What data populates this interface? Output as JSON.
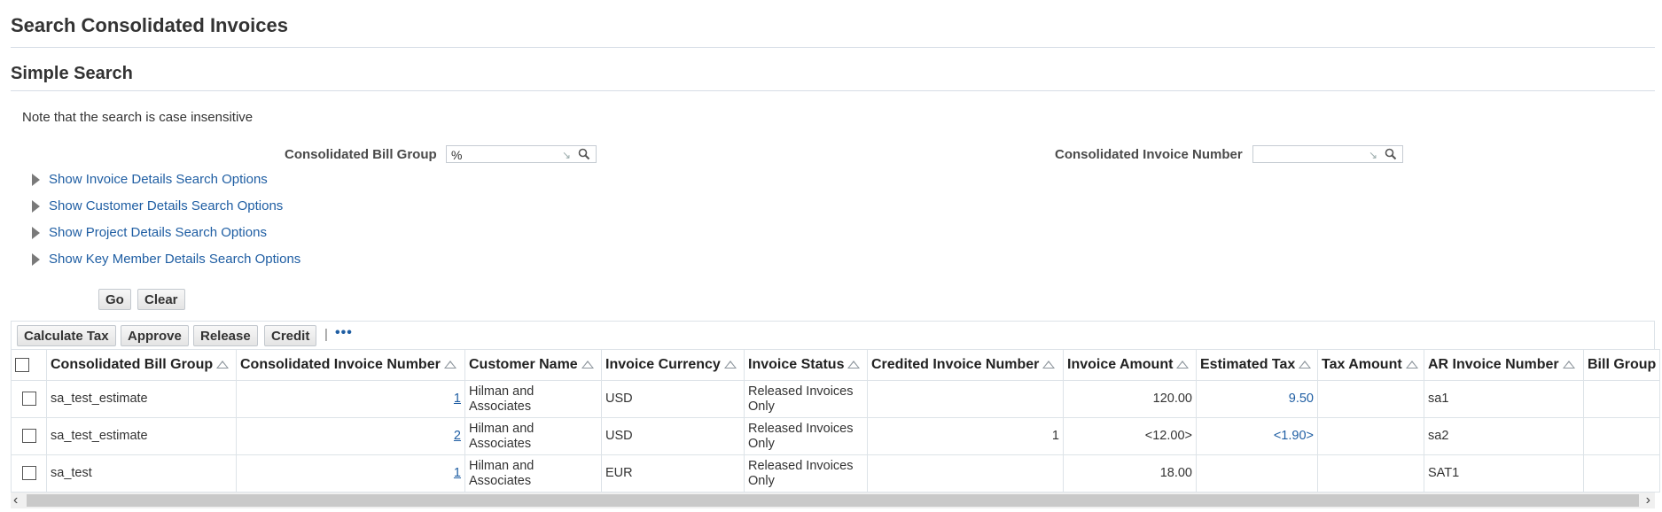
{
  "page": {
    "title": "Search Consolidated Invoices"
  },
  "simple_search": {
    "title": "Simple Search",
    "note": "Note that the search is case insensitive",
    "bill_group_label": "Consolidated Bill Group",
    "bill_group_value": "%",
    "invoice_number_label": "Consolidated Invoice Number",
    "invoice_number_value": "",
    "disclosures": [
      "Show Invoice Details Search Options",
      "Show Customer Details Search Options",
      "Show Project Details Search Options",
      "Show Key Member Details Search Options"
    ],
    "go_label": "Go",
    "clear_label": "Clear"
  },
  "toolbar": {
    "calculate_tax": "Calculate Tax",
    "approve": "Approve",
    "release": "Release",
    "credit": "Credit",
    "separator": "|",
    "more": "•••"
  },
  "table": {
    "columns": [
      "Consolidated Bill Group",
      "Consolidated Invoice Number",
      "Customer Name",
      "Invoice Currency",
      "Invoice Status",
      "Credited Invoice Number",
      "Invoice Amount",
      "Estimated Tax",
      "Tax Amount",
      "AR Invoice Number",
      "Bill Group"
    ],
    "rows": [
      {
        "bill_group": "sa_test_estimate",
        "invoice_number": "1",
        "customer": "Hilman and Associates",
        "currency": "USD",
        "status": "Released Invoices Only",
        "credited": "",
        "amount": "120.00",
        "est_tax": "9.50",
        "tax_amount": "",
        "ar_invoice": "sa1",
        "bill_group2": ""
      },
      {
        "bill_group": "sa_test_estimate",
        "invoice_number": "2",
        "customer": "Hilman and Associates",
        "currency": "USD",
        "status": "Released Invoices Only",
        "credited": "1",
        "amount": "<12.00>",
        "est_tax": "<1.90>",
        "tax_amount": "",
        "ar_invoice": "sa2",
        "bill_group2": ""
      },
      {
        "bill_group": "sa_test",
        "invoice_number": "1",
        "customer": "Hilman and Associates",
        "currency": "EUR",
        "status": "Released Invoices Only",
        "credited": "",
        "amount": "18.00",
        "est_tax": "",
        "tax_amount": "",
        "ar_invoice": "SAT1",
        "bill_group2": ""
      }
    ]
  },
  "colors": {
    "link": "#1f5ea3",
    "border": "#dde3e8"
  },
  "icons": {
    "search": "magnifier-icon",
    "disclose": "triangle-right-icon"
  }
}
